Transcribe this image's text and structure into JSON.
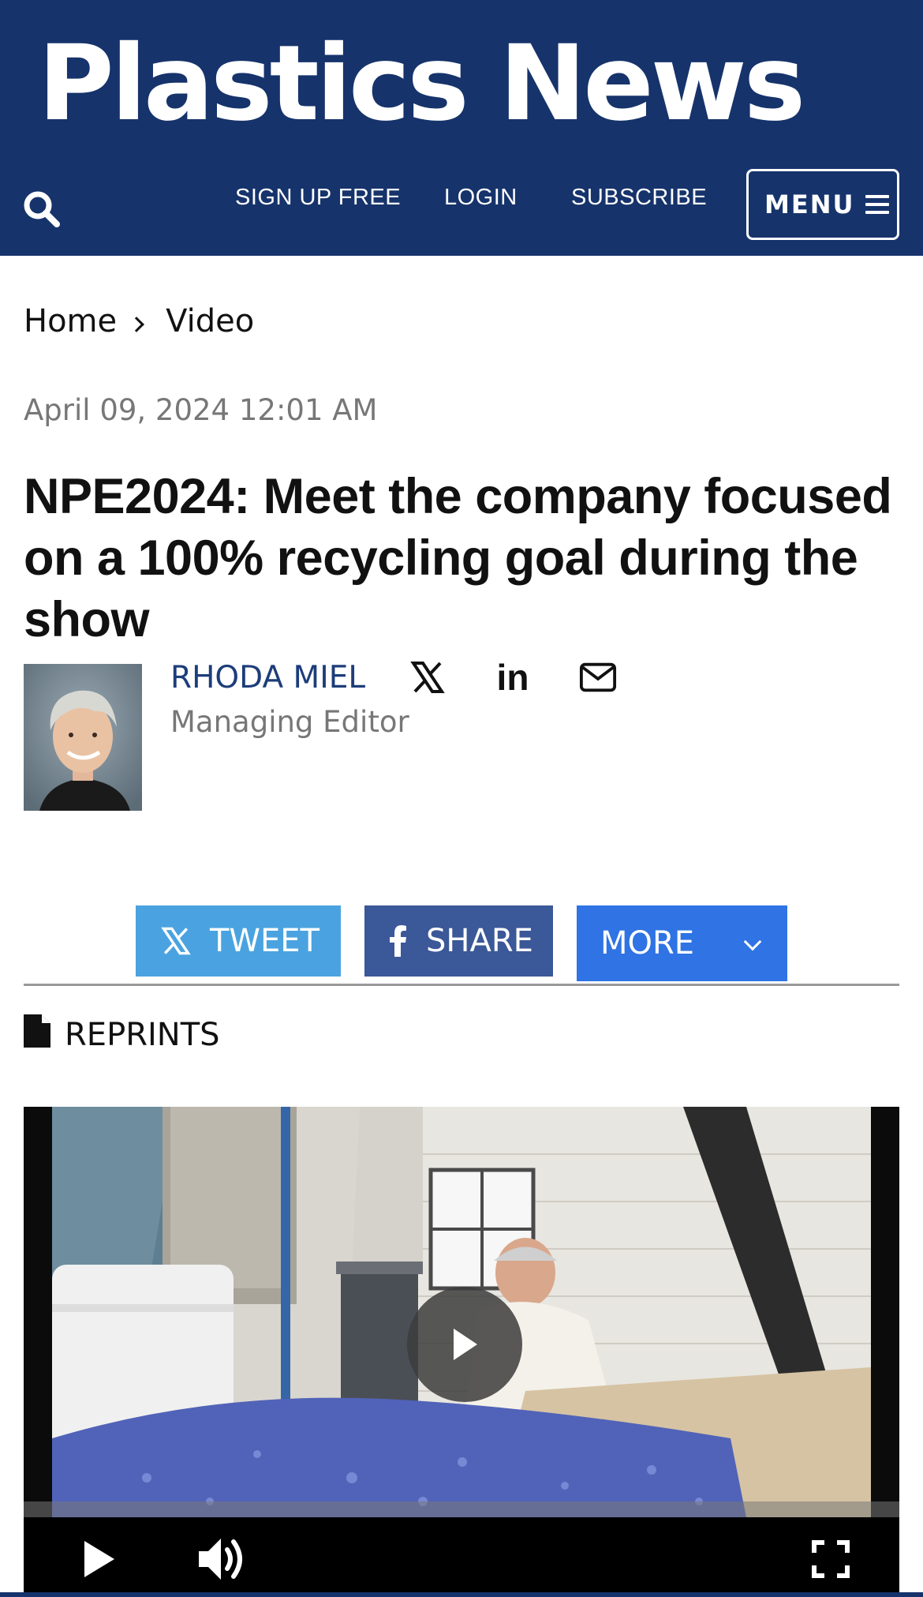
{
  "header": {
    "logo_text": "Plastics News",
    "nav": {
      "sign_up": "SIGN UP FREE",
      "login": "LOGIN",
      "subscribe": "SUBSCRIBE"
    },
    "menu_label": "MENU",
    "search_icon": "search-icon",
    "menu_icon": "hamburger-icon",
    "background_color": "#16336b"
  },
  "breadcrumb": {
    "home": "Home",
    "current": "Video"
  },
  "article": {
    "date": "April 09, 2024 12:01 AM",
    "headline": "NPE2024: Meet the company focused on a 100% recycling goal during the show",
    "author": {
      "name": "RHODA MIEL",
      "title": "Managing Editor",
      "social_icons": [
        "x-icon",
        "linkedin-icon",
        "email-icon"
      ],
      "linkedin_glyph": "in"
    }
  },
  "share": {
    "tweet_label": "TWEET",
    "share_label": "SHARE",
    "more_label": "MORE",
    "tweet_color": "#4aa3e0",
    "facebook_color": "#3b5898",
    "more_color": "#2f73e4"
  },
  "reprints_label": "REPRINTS",
  "video": {
    "controls": [
      "play-icon",
      "volume-icon",
      "fullscreen-icon"
    ]
  }
}
